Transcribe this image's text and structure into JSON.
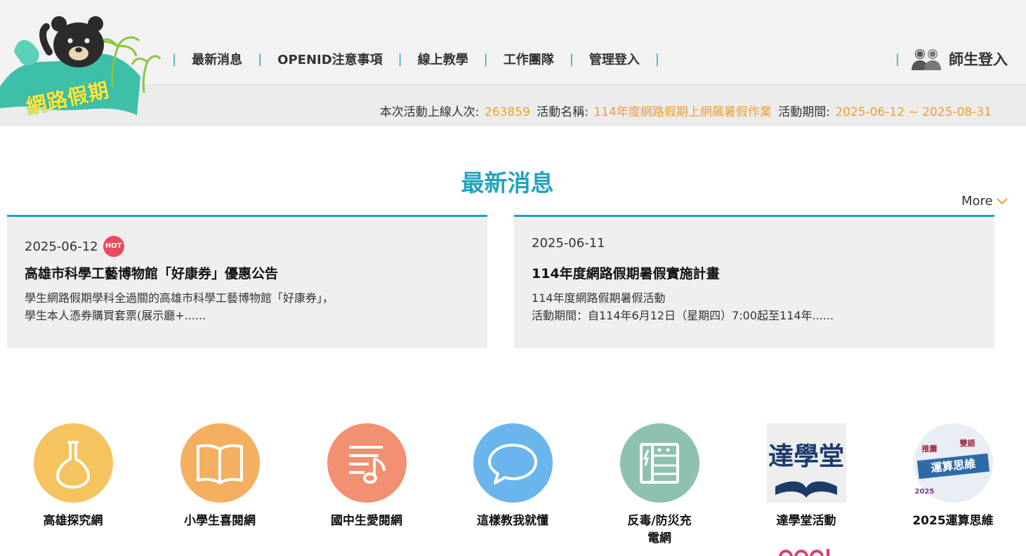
{
  "logo": {
    "text": "網路假期"
  },
  "nav": {
    "items": [
      "最新消息",
      "OPENID注意事項",
      "線上教學",
      "工作團隊",
      "管理登入"
    ],
    "separator": "|",
    "login_label": "師生登入"
  },
  "stats": {
    "online_label": "本次活動上線人次:",
    "online_value": "263859",
    "activity_label": "活動名稱:",
    "activity_value": "114年度網路假期上網飆暑假作業",
    "period_label": "活動期間:",
    "period_value": "2025-06-12 ~ 2025-08-31"
  },
  "news": {
    "title": "最新消息",
    "more_label": "More",
    "cards": [
      {
        "date": "2025-06-12",
        "badge": "HOT",
        "title": "高雄市科學工藝博物館「好康券」優惠公告",
        "line1": "學生網路假期學科全過關的高雄市科學工藝博物館「好康券」，",
        "line2": "學生本人憑券購買套票(展示廳+......"
      },
      {
        "date": "2025-06-11",
        "title": "114年度網路假期暑假實施計畫",
        "line1": "114年度網路假期暑假活動",
        "line2": "活動期間：自114年6月12日（星期四）7:00起至114年......"
      }
    ]
  },
  "links": [
    {
      "label": "高雄探究網",
      "color": "#f5c45e",
      "icon": "flask-icon"
    },
    {
      "label": "小學生喜閱網",
      "color": "#f4b060",
      "icon": "book-icon"
    },
    {
      "label": "國中生愛閱網",
      "color": "#f39071",
      "icon": "music-note-icon"
    },
    {
      "label": "這樣教我就懂",
      "color": "#6ab6ec",
      "icon": "chat-bubble-icon"
    },
    {
      "label": "反毒/防災充",
      "label2": "電網",
      "color": "#8fc2ae",
      "icon": "charger-icon"
    },
    {
      "label": "達學堂活動",
      "image_text": "達學堂",
      "icon": "daxuetang-logo"
    },
    {
      "label": "2025運算思維",
      "image_text": "運算思維",
      "image_tag1": "推薦",
      "image_tag2": "雙語",
      "image_year": "2025",
      "icon": "computational-thinking-logo"
    }
  ]
}
